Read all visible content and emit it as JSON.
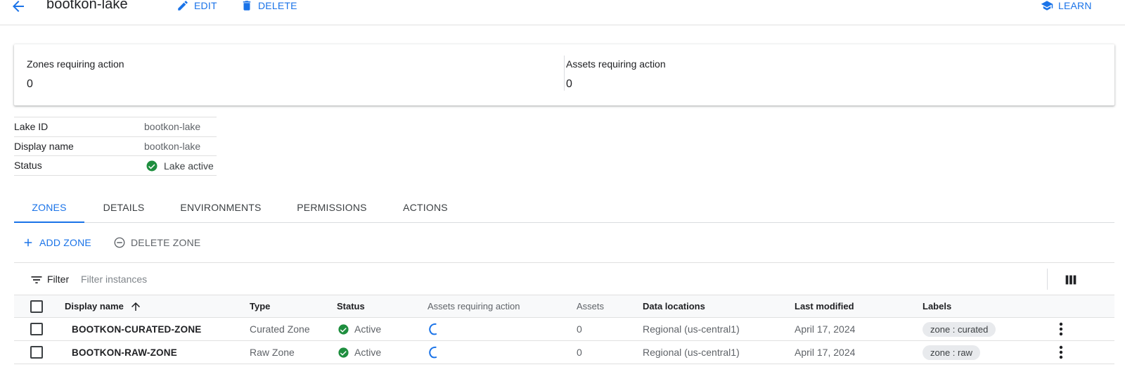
{
  "header": {
    "title": "bootkon-lake",
    "edit_label": "EDIT",
    "delete_label": "DELETE",
    "learn_label": "LEARN",
    "accent": "#1a73e8"
  },
  "summary": {
    "zones_label": "Zones requiring action",
    "zones_value": "0",
    "assets_label": "Assets requiring action",
    "assets_value": "0"
  },
  "info": {
    "lake_id_key": "Lake ID",
    "lake_id_value": "bootkon-lake",
    "display_name_key": "Display name",
    "display_name_value": "bootkon-lake",
    "status_key": "Status",
    "status_value": "Lake active",
    "status_color": "#1e8e3e"
  },
  "tabs": [
    "ZONES",
    "DETAILS",
    "ENVIRONMENTS",
    "PERMISSIONS",
    "ACTIONS"
  ],
  "actions": {
    "add_zone": "ADD ZONE",
    "delete_zone": "DELETE ZONE"
  },
  "filter": {
    "label": "Filter",
    "placeholder": "Filter instances"
  },
  "table": {
    "headers": {
      "display_name": "Display name",
      "type": "Type",
      "status": "Status",
      "assets_requiring_action": "Assets requiring action",
      "assets": "Assets",
      "data_locations": "Data locations",
      "last_modified": "Last modified",
      "labels": "Labels"
    },
    "rows": [
      {
        "name": "BOOTKON-CURATED-ZONE",
        "type": "Curated Zone",
        "status": "Active",
        "assets": "0",
        "location": "Regional (us-central1)",
        "modified": "April 17, 2024",
        "label": "zone : curated"
      },
      {
        "name": "BOOTKON-RAW-ZONE",
        "type": "Raw Zone",
        "status": "Active",
        "assets": "0",
        "location": "Regional (us-central1)",
        "modified": "April 17, 2024",
        "label": "zone : raw"
      }
    ]
  }
}
